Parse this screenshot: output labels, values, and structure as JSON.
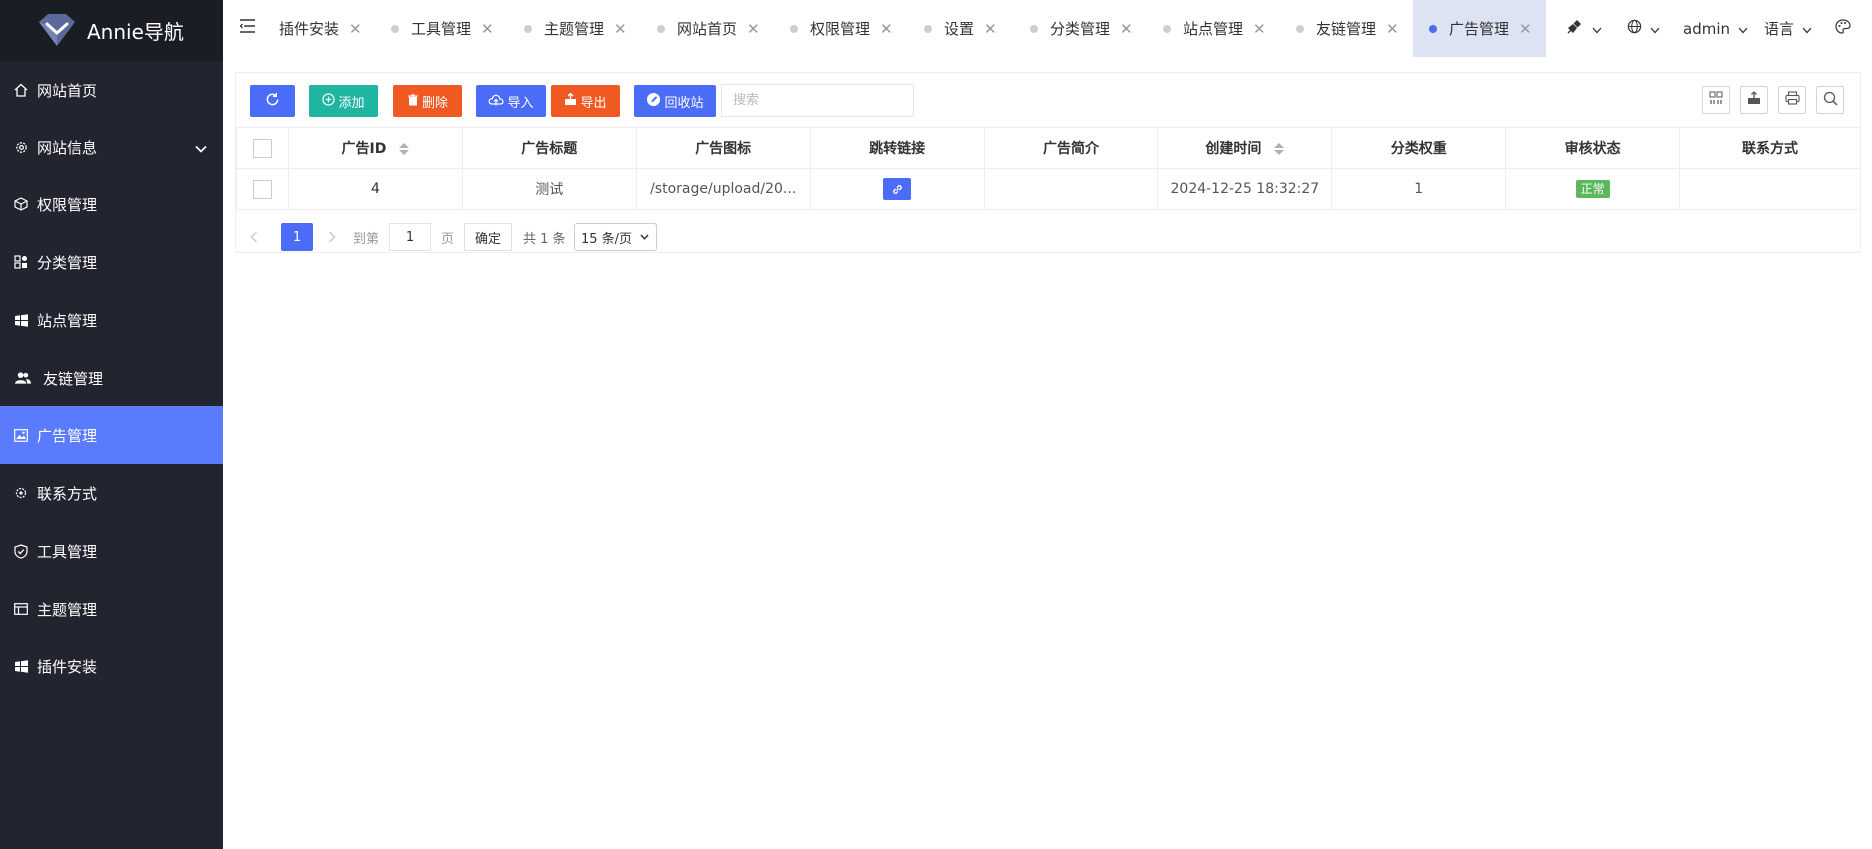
{
  "app": {
    "logo_text": "Annie导航"
  },
  "sidebar": {
    "items": [
      {
        "label": "网站首页",
        "icon": "home-icon"
      },
      {
        "label": "网站信息",
        "icon": "gear-icon",
        "has_submenu": true
      },
      {
        "label": "权限管理",
        "icon": "cube-icon"
      },
      {
        "label": "分类管理",
        "icon": "apps-icon"
      },
      {
        "label": "站点管理",
        "icon": "windows-icon"
      },
      {
        "label": "友链管理",
        "icon": "users-icon"
      },
      {
        "label": "广告管理",
        "icon": "image-icon",
        "active": true
      },
      {
        "label": "联系方式",
        "icon": "settings-icon"
      },
      {
        "label": "工具管理",
        "icon": "shield-icon"
      },
      {
        "label": "主题管理",
        "icon": "table-icon"
      },
      {
        "label": "插件安装",
        "icon": "windows-icon"
      }
    ]
  },
  "tabs": [
    {
      "label": "插件安装",
      "has_dot": false
    },
    {
      "label": "工具管理",
      "has_dot": true
    },
    {
      "label": "主题管理",
      "has_dot": true
    },
    {
      "label": "网站首页",
      "has_dot": true
    },
    {
      "label": "权限管理",
      "has_dot": true
    },
    {
      "label": "设置",
      "has_dot": true
    },
    {
      "label": "分类管理",
      "has_dot": true
    },
    {
      "label": "站点管理",
      "has_dot": true
    },
    {
      "label": "友链管理",
      "has_dot": true
    },
    {
      "label": "广告管理",
      "has_dot": true,
      "active": true
    }
  ],
  "header_right": {
    "user": "admin",
    "language": "语言"
  },
  "toolbar": {
    "add_label": "添加",
    "delete_label": "删除",
    "import_label": "导入",
    "export_label": "导出",
    "recycle_label": "回收站",
    "search_placeholder": "搜索"
  },
  "table": {
    "headers": [
      "广告ID",
      "广告标题",
      "广告图标",
      "跳转链接",
      "广告简介",
      "创建时间",
      "分类权重",
      "审核状态",
      "联系方式"
    ],
    "rows": [
      {
        "id": "4",
        "title": "测试",
        "icon_path": "/storage/upload/20...",
        "intro": "",
        "created": "2024-12-25 18:32:27",
        "weight": "1",
        "status": "正常",
        "contact": ""
      }
    ]
  },
  "pager": {
    "current_page": "1",
    "goto_label": "到第",
    "goto_value": "1",
    "page_unit": "页",
    "confirm_label": "确定",
    "total_label": "共 1 条",
    "per_page": "15 条/页"
  },
  "colors": {
    "sidebar_bg": "#222530",
    "accent": "#5a7bfb",
    "add": "#1fb5a0",
    "delete": "#f05a22",
    "status_ok": "#5cb85c"
  }
}
